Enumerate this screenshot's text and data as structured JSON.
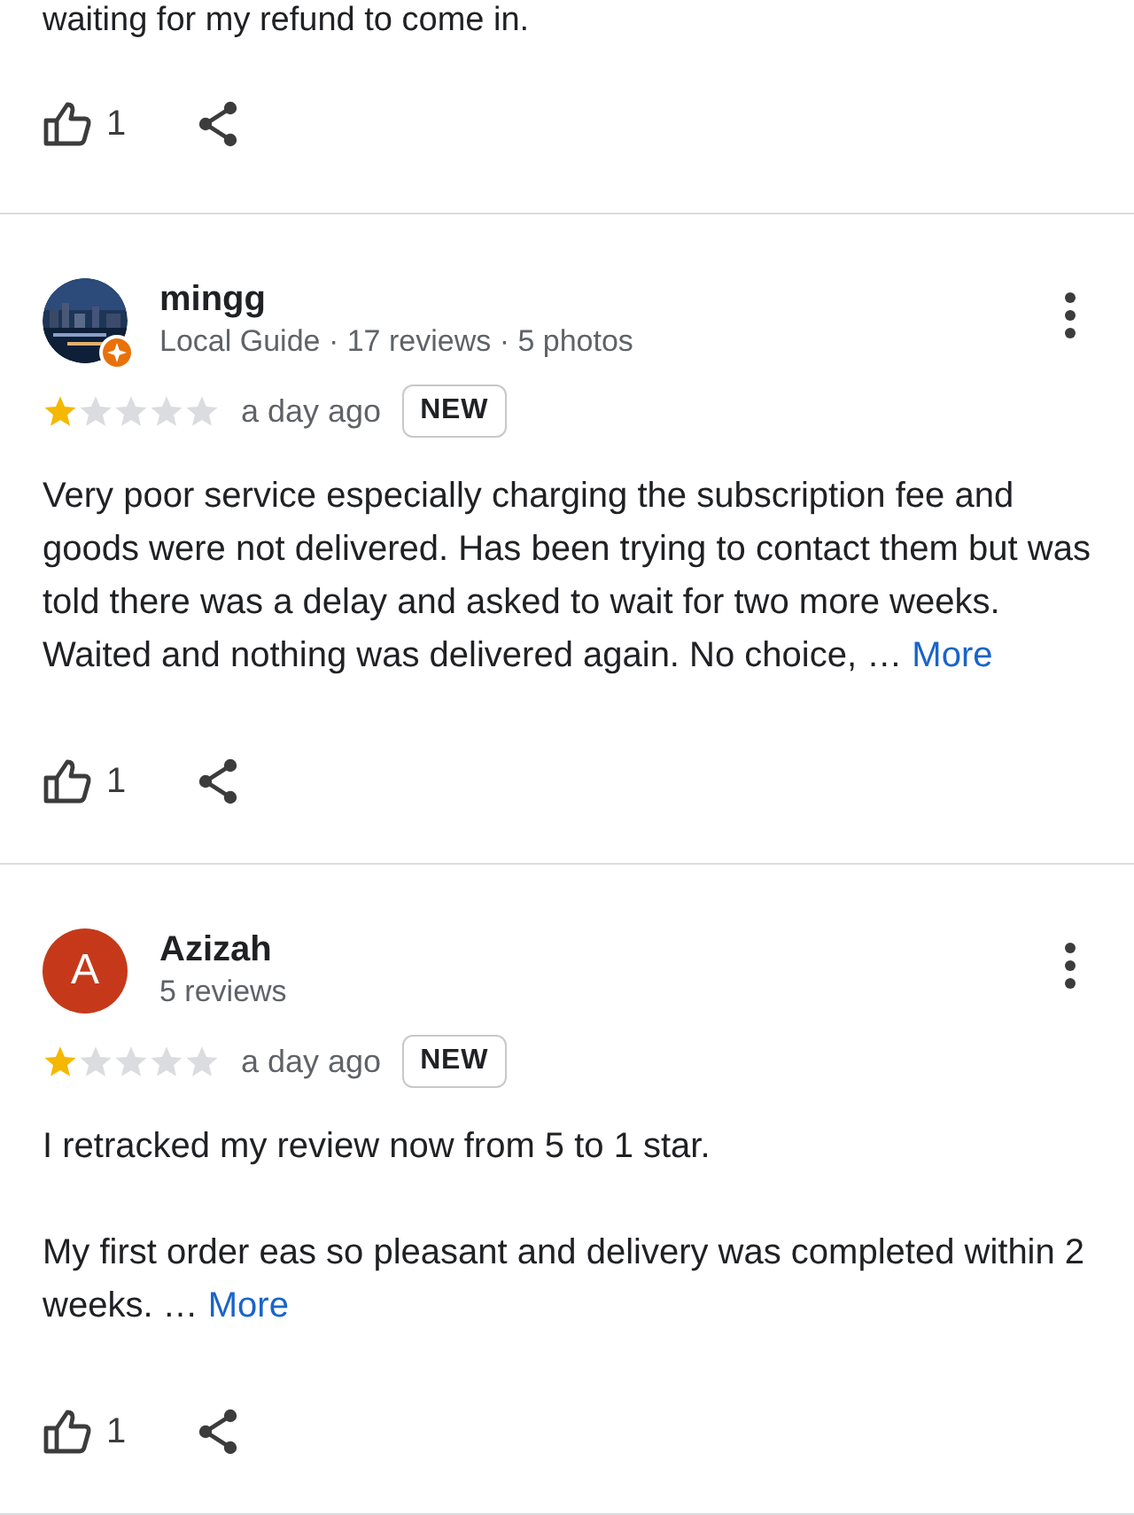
{
  "top_review": {
    "text_tail": "waiting for my refund to come in.",
    "likes": "1"
  },
  "reviews": [
    {
      "name": "mingg",
      "avatar": {
        "kind": "picture",
        "local_guide": true
      },
      "meta": "Local Guide · 17 reviews · 5 photos",
      "stars": 1,
      "time": "a day ago",
      "badge": "NEW",
      "paragraphs": [
        "Very poor service especially charging the subscription fee and goods were not delivered. Has been trying to contact them but was told there was a delay and asked to wait for two more weeks. Waited and nothing was delivered again. No choice, …"
      ],
      "more": "More",
      "likes": "1"
    },
    {
      "name": "Azizah",
      "avatar": {
        "kind": "letter",
        "letter": "A",
        "color": "#c5391a",
        "local_guide": false
      },
      "meta": "5 reviews",
      "stars": 1,
      "time": "a day ago",
      "badge": "NEW",
      "paragraphs": [
        "I retracked my review now from 5 to 1 star.",
        "My first order eas so pleasant and delivery was completed within 2 weeks. …"
      ],
      "more": "More",
      "likes": "1"
    }
  ]
}
